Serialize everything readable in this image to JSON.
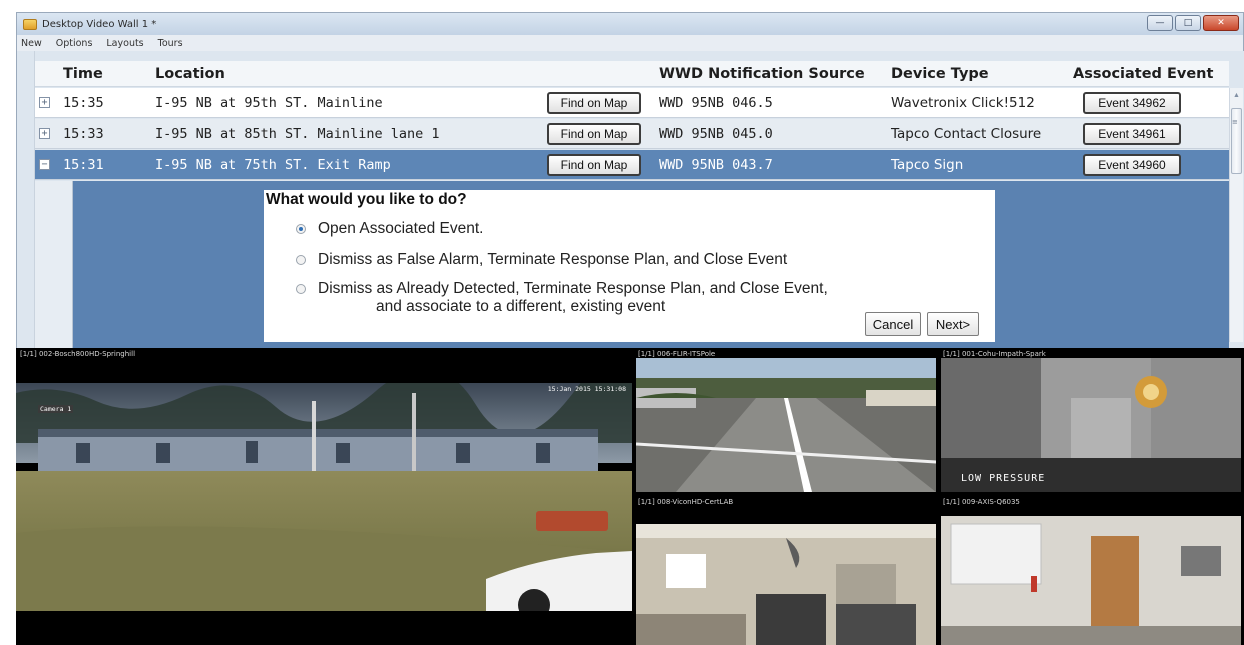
{
  "window": {
    "title": "Desktop Video Wall 1 *",
    "controls": [
      "minimize",
      "maximize",
      "close"
    ]
  },
  "menu": [
    "New",
    "Options",
    "Layouts",
    "Tours"
  ],
  "grid": {
    "columns": [
      "Time",
      "Location",
      "WWD Notification Source",
      "Device Type",
      "Associated Event"
    ],
    "rows": [
      {
        "expander": "+",
        "time": "15:35",
        "location": "I-95 NB at 95th ST. Mainline",
        "map_button": "Find on Map",
        "source": "WWD 95NB 046.5",
        "device": "Wavetronix Click!512",
        "event": "Event 34962"
      },
      {
        "expander": "+",
        "time": "15:33",
        "location": "I-95 NB at 85th ST. Mainline lane 1",
        "map_button": "Find on Map",
        "source": "WWD 95NB 045.0",
        "device": "Tapco Contact Closure",
        "event": "Event 34961"
      },
      {
        "expander": "−",
        "time": "15:31",
        "location": "I-95 NB at 75th ST. Exit Ramp",
        "map_button": "Find on Map",
        "source": "WWD 95NB 043.7",
        "device": "Tapco Sign",
        "event": "Event 34960"
      }
    ],
    "selected_row": 2
  },
  "dialog": {
    "question": "What would you like to do?",
    "options": [
      {
        "line1": "Open Associated Event.",
        "line2": "",
        "selected": true
      },
      {
        "line1": "Dismiss as False Alarm, Terminate Response Plan, and Close Event",
        "line2": "",
        "selected": false
      },
      {
        "line1": "Dismiss as Already Detected, Terminate Response Plan, and Close Event,",
        "line2": "and associate to a different, existing event",
        "selected": false
      }
    ],
    "cancel_label": "Cancel",
    "next_label": "Next>"
  },
  "video_wall": {
    "tiles": [
      {
        "label": "[1/1] 002-Bosch800HD-Springhill",
        "osd_left": "Camera 1",
        "osd_right": "15:Jan 2015  15:31:08"
      },
      {
        "label": "[1/1] 006-FLIR-ITSPole"
      },
      {
        "label": "[1/1] 001-Cohu-Impath-Spark",
        "osd_bottom": "LOW PRESSURE"
      },
      {
        "label": "[1/1] 008-ViconHD-CertLAB"
      },
      {
        "label": "[1/1] 009-AXIS-Q6035"
      }
    ]
  },
  "colors": {
    "selected_row": "#5d86b6",
    "detail_panel": "#5b82b1",
    "window_bg": "#dfe6ee"
  }
}
